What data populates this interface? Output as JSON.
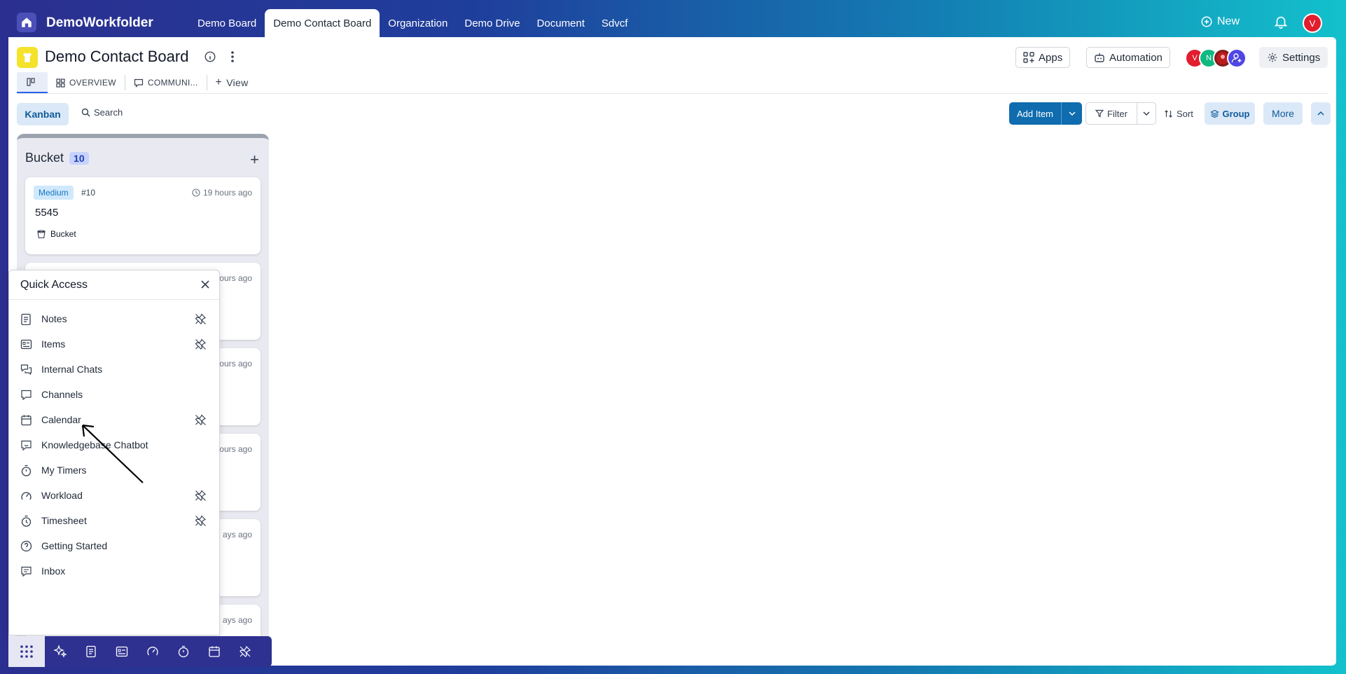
{
  "workspace": {
    "name": "DemoWorkfolder"
  },
  "tabs": [
    {
      "label": "Demo Board"
    },
    {
      "label": "Demo Contact Board",
      "active": true
    },
    {
      "label": "Organization"
    },
    {
      "label": "Demo Drive"
    },
    {
      "label": "Document"
    },
    {
      "label": "Sdvcf"
    }
  ],
  "topbar": {
    "new_label": "New",
    "user_initial": "V"
  },
  "board": {
    "title": "Demo Contact Board",
    "apps_label": "Apps",
    "automation_label": "Automation",
    "settings_label": "Settings",
    "members": [
      {
        "initial": "V",
        "color": "#e11d2e"
      },
      {
        "initial": "N",
        "color": "#10b981"
      },
      {
        "initial": "",
        "color": "#b91c1c"
      },
      {
        "initial": "",
        "color": "#4f46e5"
      }
    ]
  },
  "views": {
    "overview_label": "OVERVIEW",
    "communi_label": "COMMUNI...",
    "add_view_label": "View"
  },
  "toolbar": {
    "kanban_label": "Kanban",
    "search_label": "Search",
    "add_item_label": "Add Item",
    "filter_label": "Filter",
    "sort_label": "Sort",
    "group_label": "Group",
    "more_label": "More"
  },
  "column": {
    "title": "Bucket",
    "count": "10",
    "cards": [
      {
        "priority": "Medium",
        "number": "#10",
        "time": "19 hours ago",
        "title": "5545",
        "bucket": "Bucket"
      },
      {
        "time_partial": "ours ago"
      },
      {
        "time_partial": "ours ago"
      },
      {
        "time_partial": "ours ago"
      },
      {
        "time_partial": "ays ago"
      },
      {
        "time_partial": "ays ago"
      }
    ]
  },
  "quick_access": {
    "title": "Quick Access",
    "items": [
      {
        "label": "Notes",
        "icon": "notes-icon",
        "pinned": true
      },
      {
        "label": "Items",
        "icon": "items-icon",
        "pinned": true
      },
      {
        "label": "Internal Chats",
        "icon": "chats-icon",
        "pinned": false
      },
      {
        "label": "Channels",
        "icon": "channels-icon",
        "pinned": false
      },
      {
        "label": "Calendar",
        "icon": "calendar-icon",
        "pinned": true
      },
      {
        "label": "Knowledgebase Chatbot",
        "icon": "chatbot-icon",
        "pinned": false
      },
      {
        "label": "My Timers",
        "icon": "timer-icon",
        "pinned": false
      },
      {
        "label": "Workload",
        "icon": "workload-icon",
        "pinned": true
      },
      {
        "label": "Timesheet",
        "icon": "timesheet-icon",
        "pinned": true
      },
      {
        "label": "Getting Started",
        "icon": "help-icon",
        "pinned": false
      },
      {
        "label": "Inbox",
        "icon": "inbox-icon",
        "pinned": false
      }
    ]
  },
  "colors": {
    "accent": "#0f6cae",
    "brand": "#2f3190",
    "priority_bg": "#cfe8fb"
  }
}
